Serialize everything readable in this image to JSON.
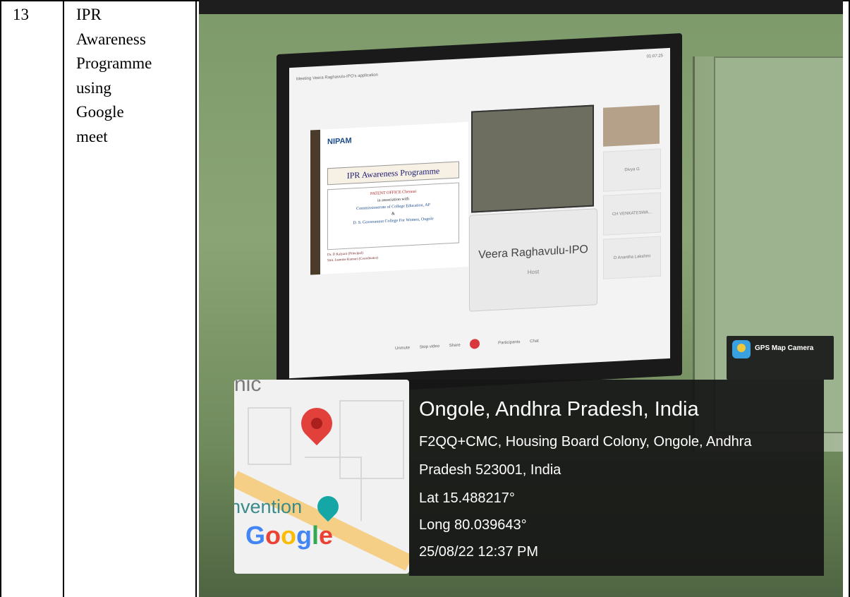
{
  "table": {
    "row_number": "13",
    "title_lines": [
      "IPR",
      "Awareness",
      "Programme",
      "using",
      "Google",
      "meet"
    ]
  },
  "screen": {
    "meeting_title": "Meeting Veera Raghavulu-IPO's application",
    "time": "01:07:25",
    "slide": {
      "logos_text": "NIPAM",
      "heading": "IPR Awareness Programme",
      "body_lines": [
        "PATENT OFFICE Chennai",
        "in association with",
        "Commissionerate of College Education, AP",
        "&",
        "D. S. Government College For Women, Ongole"
      ],
      "footer_lines": [
        "Dr. D Kalyani (Principal)",
        "Smt. Jasmine Kumari (Coordinator)"
      ]
    },
    "host_name": "Veera Raghavulu-IPO",
    "host_role": "Host",
    "participants": [
      "Divya G",
      "CH VENKATESWA...",
      "D Anantha Lakshmi"
    ],
    "toolbar": [
      "Unmute",
      "Stop video",
      "Share",
      "Participants",
      "Chat"
    ]
  },
  "gps_badge": {
    "label": "GPS Map Camera"
  },
  "map": {
    "label_top": "nic",
    "label_poi": "nvention",
    "google": "Google",
    "google_colors": [
      "#4285F4",
      "#EA4335",
      "#FBBC05",
      "#4285F4",
      "#34A853",
      "#EA4335"
    ]
  },
  "location": {
    "title": "Ongole, Andhra Pradesh, India",
    "address_line1": "F2QQ+CMC, Housing Board Colony, Ongole, Andhra",
    "address_line2": "Pradesh 523001, India",
    "lat": "Lat 15.488217°",
    "long": "Long 80.039643°",
    "datetime": "25/08/22 12:37 PM"
  }
}
